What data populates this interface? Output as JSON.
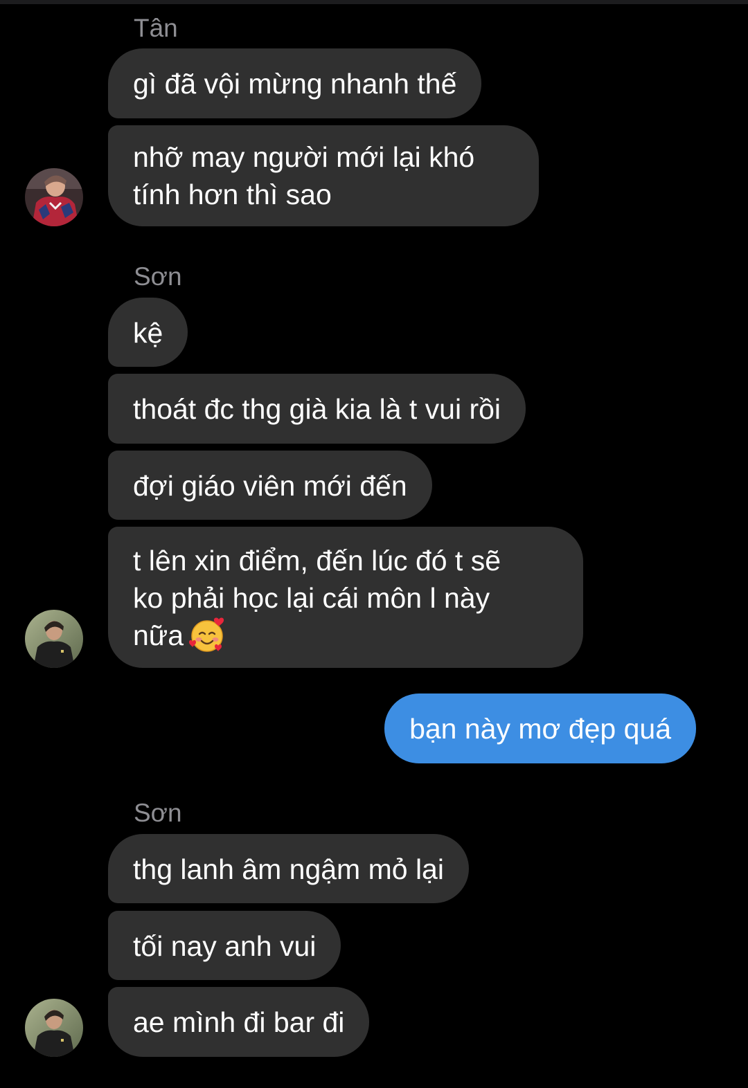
{
  "conversation": {
    "groups": [
      {
        "sender": "Tân",
        "messages": [
          {
            "text": "gì đã vội mừng nhanh thế"
          },
          {
            "lines": [
              "nhỡ may người mới lại khó",
              "tính hơn thì sao"
            ]
          }
        ]
      },
      {
        "sender": "Sơn",
        "messages": [
          {
            "text": "kệ"
          },
          {
            "text": "thoát đc thg già kia là t vui rồi"
          },
          {
            "text": "đợi giáo viên mới đến"
          },
          {
            "lines": [
              "t lên xin điểm, đến lúc đó t sẽ",
              "ko phải học lại cái môn l này",
              "nữa"
            ],
            "emoji": "smiling-face-with-hearts-emoji"
          }
        ]
      },
      {
        "outgoing": true,
        "messages": [
          {
            "text": "bạn này mơ đẹp quá"
          }
        ]
      },
      {
        "sender": "Sơn",
        "messages": [
          {
            "text": "thg lanh âm ngậm mỏ lại"
          },
          {
            "text": "tối nay anh vui"
          },
          {
            "text": "ae mình đi bar đi"
          }
        ]
      }
    ]
  },
  "colors": {
    "background": "#000000",
    "incoming_bubble": "#303030",
    "outgoing_bubble": "#3d8ee3",
    "sender_name": "#8e8e93",
    "text": "#ffffff"
  },
  "icons": {
    "tan_avatar": "avatar-tan",
    "son_avatar": "avatar-son"
  }
}
